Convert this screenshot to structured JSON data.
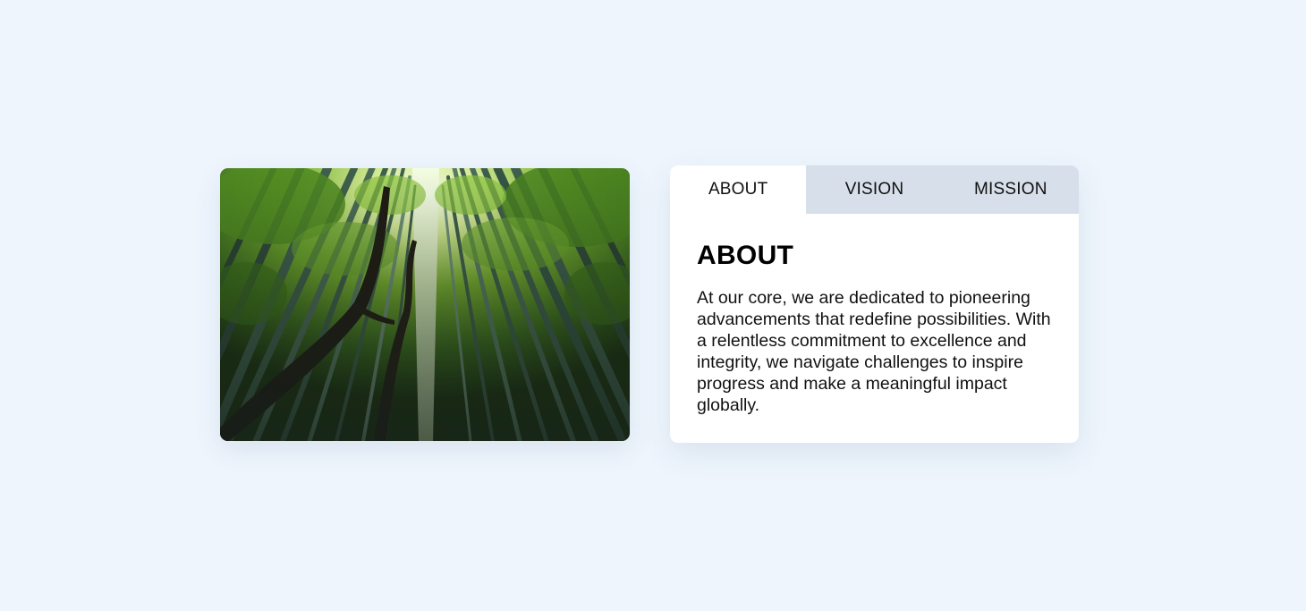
{
  "image": {
    "alt": "",
    "colors": {
      "sky": "#f4fbe9",
      "canopy_light": "#8fc23f",
      "canopy_dark": "#2f5a17",
      "stalk": "#3c5a4a",
      "trunk": "#1e1a14"
    }
  },
  "tabs": [
    {
      "label": "ABOUT",
      "active": true
    },
    {
      "label": "VISION",
      "active": false
    },
    {
      "label": "MISSION",
      "active": false
    }
  ],
  "panel": {
    "heading": "ABOUT",
    "body": "At our core, we are dedicated to pioneering advancements that redefine possibilities. With a relentless commitment to excellence and integrity, we navigate challenges to inspire progress and make a meaningful impact globally."
  },
  "colors": {
    "page_background": "#eef5fd",
    "tab_inactive": "#d7dfea",
    "tab_active": "#ffffff"
  }
}
